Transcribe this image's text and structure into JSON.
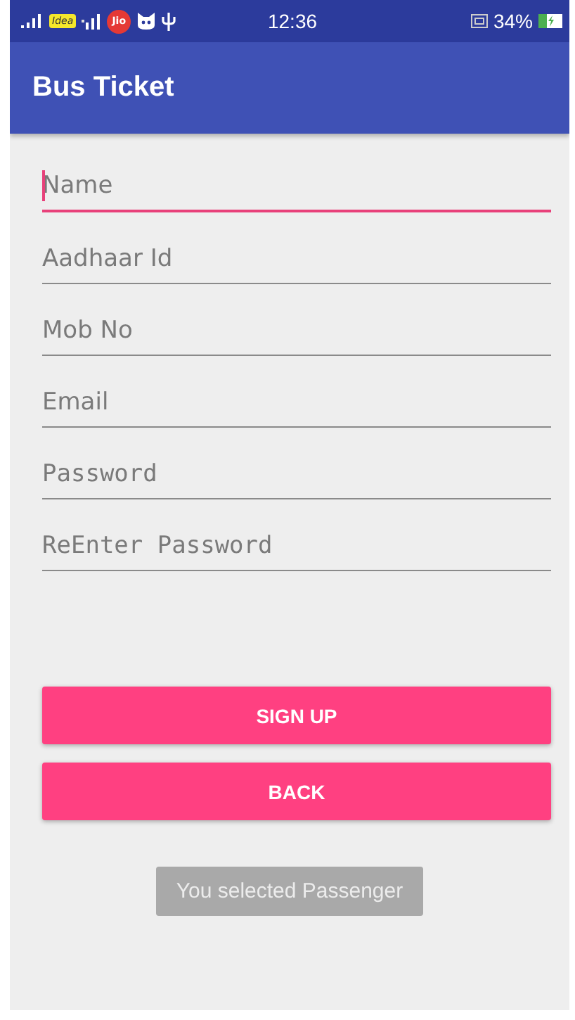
{
  "status_bar": {
    "carrier_1": "Idea",
    "carrier_2": "Jio",
    "time": "12:36",
    "battery": "34%"
  },
  "app_bar": {
    "title": "Bus Ticket"
  },
  "fields": [
    {
      "placeholder": "Name",
      "kind": "text",
      "focused": true
    },
    {
      "placeholder": "Aadhaar Id",
      "kind": "text",
      "focused": false
    },
    {
      "placeholder": "Mob No",
      "kind": "text",
      "focused": false
    },
    {
      "placeholder": "Email",
      "kind": "text",
      "focused": false
    },
    {
      "placeholder": "Password",
      "kind": "password",
      "focused": false
    },
    {
      "placeholder": "ReEnter Password",
      "kind": "password",
      "focused": false
    }
  ],
  "buttons": [
    "SIGN UP",
    "BACK"
  ],
  "toast": "You selected Passenger"
}
